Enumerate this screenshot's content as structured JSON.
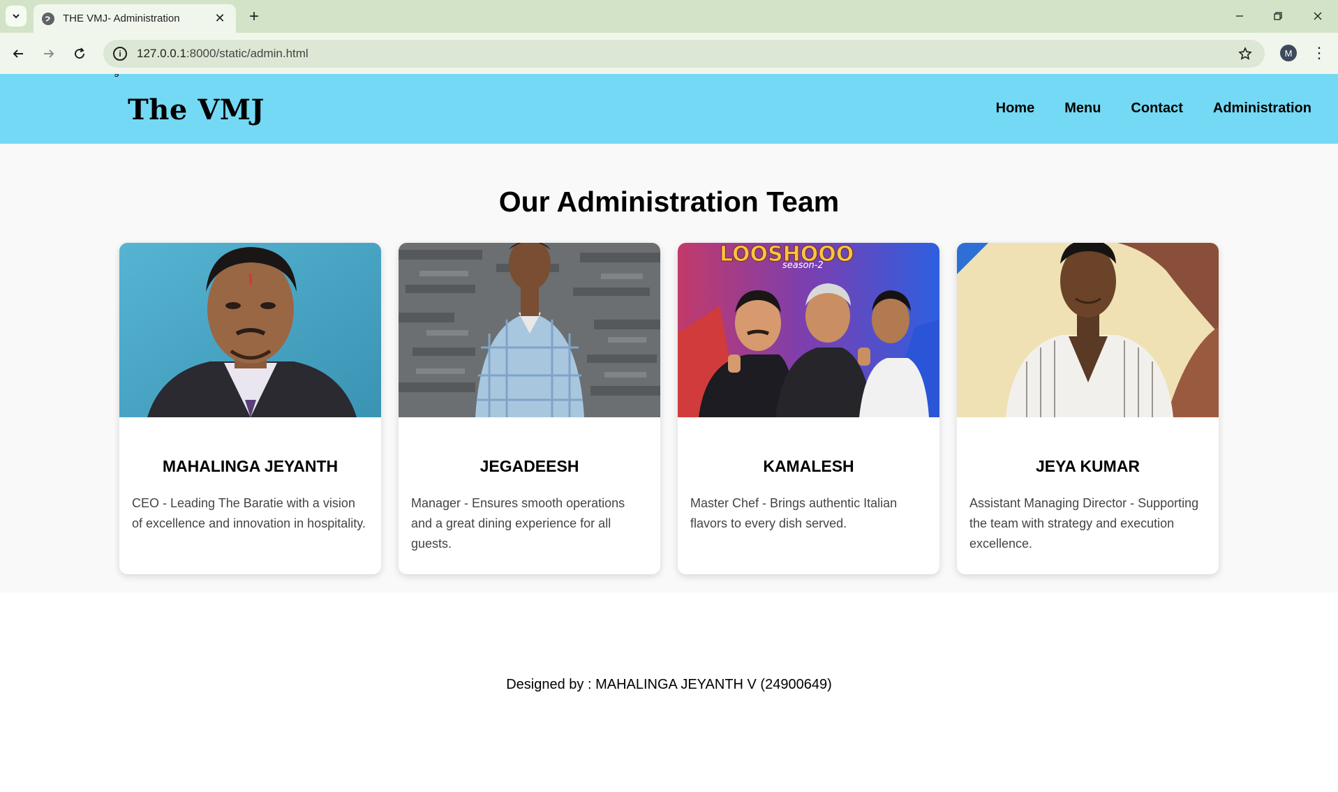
{
  "browser": {
    "tab_title": "THE VMJ- Administration",
    "url_host": "127.0.0.1",
    "url_path": ":8000/static/admin.html",
    "profile_initial": "M"
  },
  "site": {
    "header_stub": "g",
    "logo": "The VMJ",
    "nav": [
      "Home",
      "Menu",
      "Contact",
      "Administration"
    ]
  },
  "team": {
    "title": "Our Administration Team",
    "members": [
      {
        "name": "MAHALINGA JEYANTH",
        "description": "CEO - Leading The Baratie with a vision of excellence and innovation in hospitality."
      },
      {
        "name": "JEGADEESH",
        "description": "Manager - Ensures smooth operations and a great dining experience for all guests."
      },
      {
        "name": "KAMALESH",
        "description": "Master Chef - Brings authentic Italian flavors to every dish served.",
        "photo_banner": "Looshoo season-2"
      },
      {
        "name": "JEYA KUMAR",
        "description": "Assistant Managing Director - Supporting the team with strategy and execution excellence."
      }
    ]
  },
  "footer": {
    "credit": "Designed by : MAHALINGA JEYANTH V (24900649)"
  },
  "colors": {
    "header_bg": "#74d9f4",
    "section_bg": "#f9f9f9",
    "chrome_bg": "#d3e3c7"
  }
}
